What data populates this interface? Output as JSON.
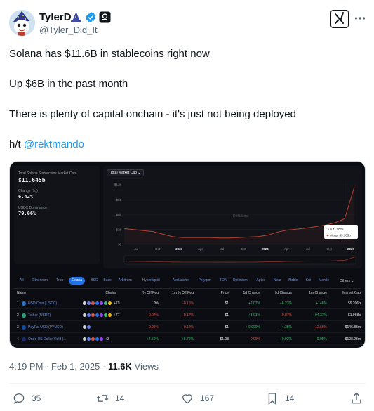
{
  "author": {
    "name": "TylerD",
    "handle": "@Tyler_Did_It"
  },
  "tweet": {
    "line1": "Solana has $11.6B in stablecoins right now",
    "line2": "Up $6B in the past month",
    "line3": "There is plenty of capital onchain - it's just not being deployed",
    "ht_prefix": "h/t ",
    "ht_mention": "@rektmando"
  },
  "dashboard": {
    "title": "Total Solana Stablecoins Market Cap",
    "total_value": "$11.645b",
    "change_label": "Change (7d)",
    "change_value": "6.42%",
    "dominance_label": "USDC Dominance",
    "dominance_value": "79.06%",
    "chart_button": "Total Market Cap",
    "watermark": "DefiLlama",
    "tooltip_date": "Jun 1, 2025",
    "tooltip_value": "Mcap: $5.163b",
    "chains": [
      "All",
      "Ethereum",
      "Tron",
      "Solana",
      "BSC",
      "Base",
      "Arbitrum",
      "Hyperliquid",
      "Avalanche",
      "Polygon",
      "TON",
      "Optimism",
      "Aptos",
      "Near",
      "Noble",
      "Sui",
      "Mantle"
    ],
    "active_chain": "Solana",
    "others_label": "Others",
    "columns": [
      "Name",
      "Chains",
      "% Off Peg",
      "1m % Off Peg",
      "Price",
      "1d Change",
      "7d Change",
      "1m Change",
      "Market Cap"
    ],
    "rows": [
      {
        "rank": "1",
        "name": "USD Coin (USDC)",
        "chains": "+79",
        "off_peg": "0%",
        "off_peg_1m": "-0.16%",
        "price": "$1",
        "d1": "+2.07%",
        "d7": "+6.23%",
        "m1": "+146%",
        "mcap": "$9.206b"
      },
      {
        "rank": "2",
        "name": "Tether (USDT)",
        "chains": "+77",
        "off_peg": "-0.07%",
        "off_peg_1m": "-0.17%",
        "price": "$1",
        "d1": "+3.01%",
        "d7": "-0.07%",
        "m1": "+94.37%",
        "mcap": "$1.968b"
      },
      {
        "rank": "3",
        "name": "PayPal USD (PYUSD)",
        "chains": "",
        "off_peg": "-0.05%",
        "off_peg_1m": "-0.12%",
        "price": "$1",
        "d1": "+ 0.000%",
        "d7": "+4.28%",
        "m1": "-12.66%",
        "mcap": "$146.83m"
      },
      {
        "rank": "4",
        "name": "Ondo US Dollar Yield (...",
        "chains": "+3",
        "off_peg": "+7.56%",
        "off_peg_1m": "+8.76%",
        "price": "$1.08",
        "d1": "-0.09%",
        "d7": "+0.93%",
        "m1": "+0.05%",
        "mcap": "$108.23m"
      }
    ]
  },
  "chart_data": {
    "type": "area",
    "title": "Total Market Cap",
    "x_ticks": [
      "Jul",
      "Oct",
      "2023",
      "Apr",
      "Jul",
      "Oct",
      "2024",
      "Apr",
      "Jul",
      "Oct",
      "2025"
    ],
    "y_ticks": [
      "$0",
      "$3b",
      "$6b",
      "$9b",
      "$12b"
    ],
    "ylim": [
      0,
      13
    ],
    "series": [
      {
        "values": [
          3.2,
          3.0,
          2.8,
          2.6,
          2.1,
          1.6,
          1.4,
          1.4,
          1.4,
          1.4,
          1.3,
          1.3,
          1.4,
          1.5,
          1.6,
          1.9,
          2.5,
          2.9,
          3.1,
          3.3,
          3.6,
          3.9,
          4.4,
          5.2,
          11.6
        ]
      }
    ]
  },
  "meta": {
    "time": "4:19 PM",
    "sep": " · ",
    "date": "Feb 1, 2025",
    "views": "11.6K",
    "views_label": " Views"
  },
  "actions": {
    "replies": "35",
    "reposts": "14",
    "likes": "167",
    "bookmarks": "14"
  },
  "colors": {
    "link": "#1d9bf0",
    "verified": "#1d9bf0",
    "chart_line": "#b74232",
    "accent": "#2172e5"
  }
}
